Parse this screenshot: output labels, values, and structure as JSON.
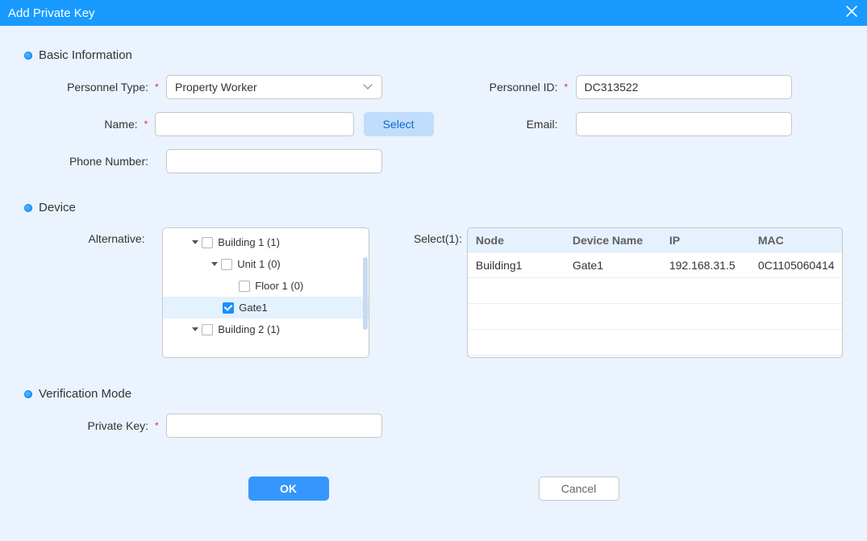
{
  "header": {
    "title": "Add Private Key"
  },
  "sections": {
    "basic": "Basic Information",
    "device": "Device",
    "verification": "Verification Mode"
  },
  "labels": {
    "personnel_type": "Personnel Type:",
    "personnel_id": "Personnel ID:",
    "name": "Name:",
    "email": "Email:",
    "phone": "Phone Number:",
    "alternative": "Alternative:",
    "select_count": "Select(1):",
    "private_key": "Private Key:"
  },
  "form": {
    "personnel_type": "Property Worker",
    "personnel_id": "DC313522",
    "name": "",
    "email": "",
    "phone": "",
    "private_key": ""
  },
  "buttons": {
    "select": "Select",
    "ok": "OK",
    "cancel": "Cancel"
  },
  "tree": {
    "items": [
      {
        "indent": 34,
        "label": "Building 1 (1)",
        "checked": false,
        "caret": true
      },
      {
        "indent": 58,
        "label": "Unit 1 (0)",
        "checked": false,
        "caret": true
      },
      {
        "indent": 80,
        "label": "Floor 1 (0)",
        "checked": false,
        "caret": false
      },
      {
        "indent": 60,
        "label": "Gate1",
        "checked": true,
        "caret": false,
        "selected": true
      },
      {
        "indent": 34,
        "label": "Building 2 (1)",
        "checked": false,
        "caret": true
      }
    ]
  },
  "table": {
    "headers": {
      "node": "Node",
      "device_name": "Device Name",
      "ip": "IP",
      "mac": "MAC"
    },
    "rows": [
      {
        "node": "Building1",
        "device_name": "Gate1",
        "ip": "192.168.31.5",
        "mac": "0C1105060414"
      }
    ]
  }
}
